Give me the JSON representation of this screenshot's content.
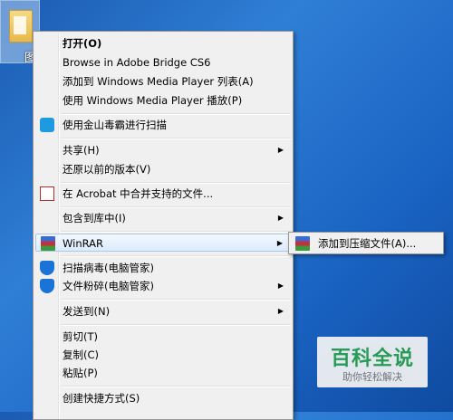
{
  "desktop": {
    "icon_label": "图"
  },
  "menu": {
    "open": "打开(O)",
    "bridge": "Browse in Adobe Bridge CS6",
    "wmp_add": "添加到 Windows Media Player 列表(A)",
    "wmp_play": "使用 Windows Media Player 播放(P)",
    "kingsoft_scan": "使用金山毒霸进行扫描",
    "share": "共享(H)",
    "restore": "还原以前的版本(V)",
    "acrobat": "在 Acrobat 中合并支持的文件...",
    "library": "包含到库中(I)",
    "winrar": "WinRAR",
    "scan_virus": "扫描病毒(电脑管家)",
    "shred": "文件粉碎(电脑管家)",
    "send_to": "发送到(N)",
    "cut": "剪切(T)",
    "copy": "复制(C)",
    "paste": "粘贴(P)",
    "shortcut": "创建快捷方式(S)"
  },
  "submenu": {
    "add_archive": "添加到压缩文件(A)..."
  },
  "watermark": {
    "title": "百科全说",
    "subtitle": "助你轻松解决"
  },
  "icons": [
    "kingsoft-icon",
    "acrobat-icon",
    "winrar-icon",
    "shield-icon"
  ]
}
